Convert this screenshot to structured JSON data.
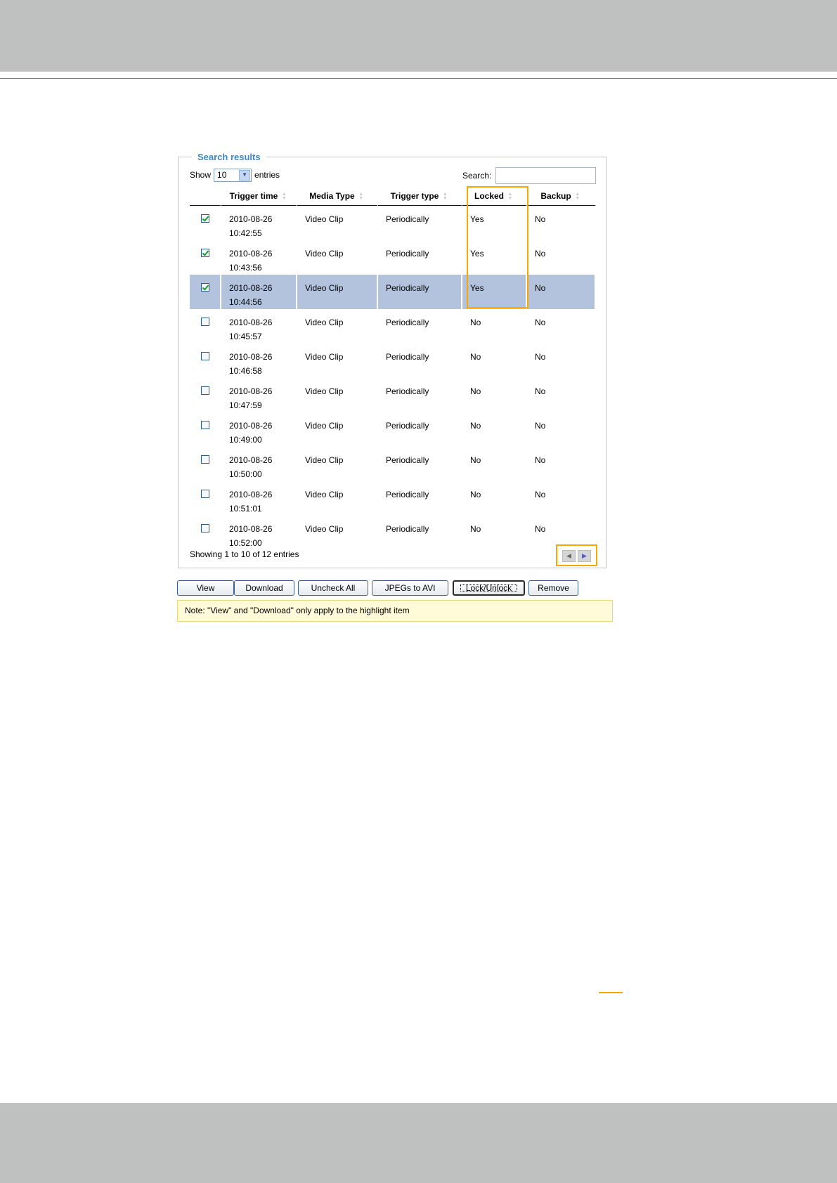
{
  "fieldset": {
    "legend": "Search results"
  },
  "length_control": {
    "prefix": "Show",
    "value": "10",
    "suffix": "entries"
  },
  "search": {
    "label": "Search:",
    "value": ""
  },
  "table": {
    "columns": [
      "",
      "Trigger time",
      "Media Type",
      "Trigger type",
      "Locked",
      "Backup"
    ],
    "rows": [
      {
        "checked": true,
        "date": "2010-08-26",
        "time": "10:42:55",
        "media": "Video Clip",
        "trigger": "Periodically",
        "locked": "Yes",
        "backup": "No"
      },
      {
        "checked": true,
        "date": "2010-08-26",
        "time": "10:43:56",
        "media": "Video Clip",
        "trigger": "Periodically",
        "locked": "Yes",
        "backup": "No"
      },
      {
        "checked": true,
        "date": "2010-08-26",
        "time": "10:44:56",
        "media": "Video Clip",
        "trigger": "Periodically",
        "locked": "Yes",
        "backup": "No",
        "highlighted": true
      },
      {
        "checked": false,
        "date": "2010-08-26",
        "time": "10:45:57",
        "media": "Video Clip",
        "trigger": "Periodically",
        "locked": "No",
        "backup": "No"
      },
      {
        "checked": false,
        "date": "2010-08-26",
        "time": "10:46:58",
        "media": "Video Clip",
        "trigger": "Periodically",
        "locked": "No",
        "backup": "No"
      },
      {
        "checked": false,
        "date": "2010-08-26",
        "time": "10:47:59",
        "media": "Video Clip",
        "trigger": "Periodically",
        "locked": "No",
        "backup": "No"
      },
      {
        "checked": false,
        "date": "2010-08-26",
        "time": "10:49:00",
        "media": "Video Clip",
        "trigger": "Periodically",
        "locked": "No",
        "backup": "No"
      },
      {
        "checked": false,
        "date": "2010-08-26",
        "time": "10:50:00",
        "media": "Video Clip",
        "trigger": "Periodically",
        "locked": "No",
        "backup": "No"
      },
      {
        "checked": false,
        "date": "2010-08-26",
        "time": "10:51:01",
        "media": "Video Clip",
        "trigger": "Periodically",
        "locked": "No",
        "backup": "No"
      },
      {
        "checked": false,
        "date": "2010-08-26",
        "time": "10:52:00",
        "media": "Video Clip",
        "trigger": "Periodically",
        "locked": "No",
        "backup": "No"
      }
    ]
  },
  "info": "Showing 1 to 10 of 12 entries",
  "pager": {
    "prev_icon": "arrow-left-icon",
    "next_icon": "arrow-right-icon"
  },
  "buttons": {
    "view": "View",
    "download": "Download",
    "uncheck_all": "Uncheck All",
    "jpegs_to_avi": "JPEGs to AVI",
    "lock_unlock": "Lock/Unlock",
    "remove": "Remove"
  },
  "note": "Note: \"View\" and \"Download\" only apply to the highlight item",
  "colors": {
    "highlight_row": "#b3c3de",
    "callout": "#f5a800",
    "legend": "#3a86c8",
    "note_bg": "#fffbd8",
    "band": "#bfc1c0"
  }
}
